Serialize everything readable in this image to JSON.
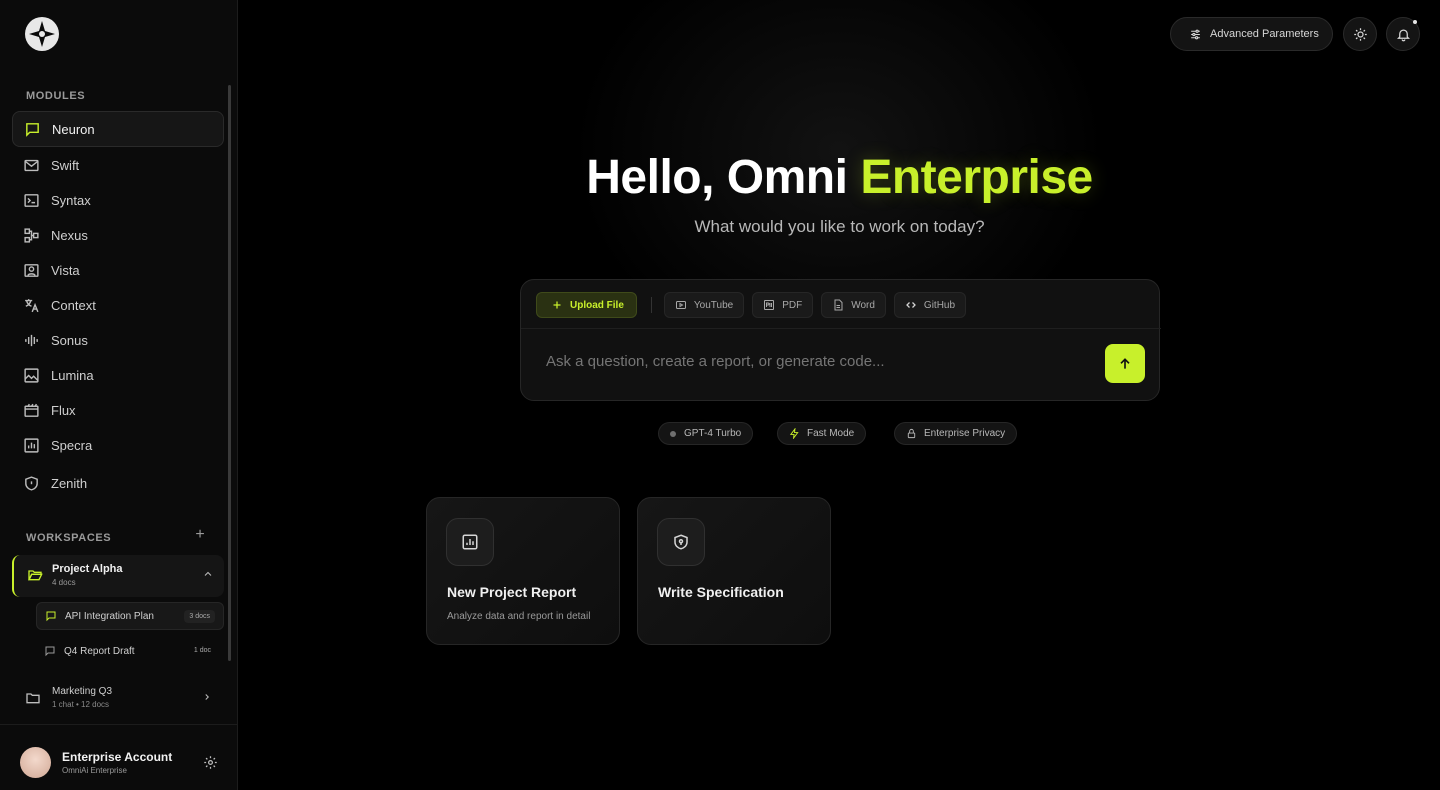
{
  "sidebar": {
    "modules_label": "MODULES",
    "items": [
      {
        "label": "Neuron",
        "icon": "chat-bubble-icon",
        "active": true
      },
      {
        "label": "Swift",
        "icon": "mail-icon"
      },
      {
        "label": "Syntax",
        "icon": "terminal-icon"
      },
      {
        "label": "Nexus",
        "icon": "network-icon"
      },
      {
        "label": "Vista",
        "icon": "user-card-icon"
      },
      {
        "label": "Context",
        "icon": "translate-icon"
      },
      {
        "label": "Sonus",
        "icon": "audio-wave-icon"
      },
      {
        "label": "Lumina",
        "icon": "image-icon"
      },
      {
        "label": "Flux",
        "icon": "film-icon"
      },
      {
        "label": "Specra",
        "icon": "bar-chart-icon"
      },
      {
        "label": "Zenith",
        "icon": "shield-icon"
      }
    ],
    "workspaces_label": "WORKSPACES",
    "workspace_add": "+",
    "project": {
      "title": "Project Alpha",
      "subtitle": "4 docs"
    },
    "project_items": [
      {
        "label": "API Integration Plan",
        "badge": "3 docs",
        "active": true
      },
      {
        "label": "Q4 Report Draft",
        "badge": "1 doc"
      }
    ],
    "marketing": {
      "title": "Marketing Q3",
      "subtitle": "1 chat • 12 docs"
    },
    "account": {
      "name": "Enterprise Account",
      "subtitle": "OmniAi Enterprise"
    }
  },
  "header": {
    "advanced_label": "Advanced Parameters"
  },
  "hero": {
    "greeting": "Hello, Omni",
    "accent": "Enterprise",
    "subtitle": "What would you like to work on today?"
  },
  "composer": {
    "upload_label": "Upload File",
    "sources": [
      "YouTube",
      "PDF",
      "Word",
      "GitHub"
    ],
    "placeholder": "Ask a question, create a report, or generate code..."
  },
  "pills": [
    {
      "label": "GPT-4 Turbo"
    },
    {
      "label": "Fast Mode"
    },
    {
      "label": "Enterprise Privacy"
    }
  ],
  "cards": [
    {
      "title": "New Project Report",
      "description": "Analyze data and report in detail"
    },
    {
      "title": "Write Specification",
      "description": ""
    }
  ],
  "colors": {
    "accent": "#c8f02b",
    "background": "#000000",
    "panel": "#111111"
  }
}
